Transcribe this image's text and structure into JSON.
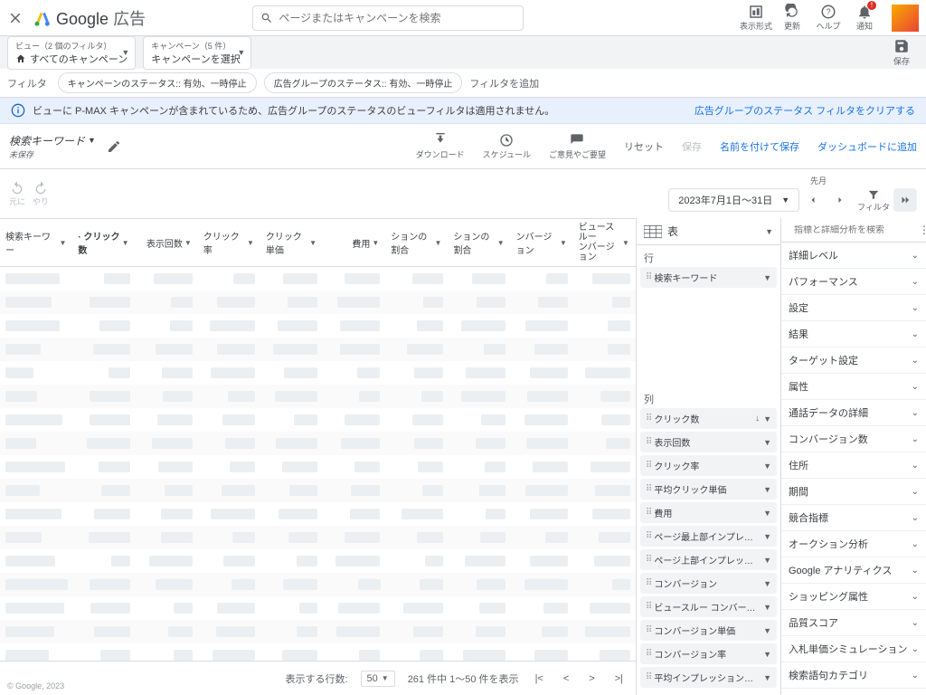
{
  "brand": {
    "name_strong": "Google",
    "name_light": "広告"
  },
  "search": {
    "placeholder": "ページまたはキャンペーンを検索"
  },
  "topactions": {
    "appearance": "表示形式",
    "refresh": "更新",
    "help": "ヘルプ",
    "notifications": "通知"
  },
  "viewbar": {
    "view_sub": "ビュー（2 個のフィルタ）",
    "view_main": "すべてのキャンペーン",
    "campaign_sub": "キャンペーン（5 件）",
    "campaign_main": "キャンペーンを選択",
    "save": "保存"
  },
  "filterbar": {
    "label": "フィルタ",
    "chip1": "キャンペーンのステータス:: 有効、一時停止",
    "chip2": "広告グループのステータス:: 有効、一時停止",
    "add": "フィルタを追加"
  },
  "banner": {
    "text": "ビューに P-MAX キャンペーンが含まれているため、広告グループのステータスのビューフィルタは適用されません。",
    "link": "広告グループのステータス フィルタをクリアする"
  },
  "report": {
    "title": "検索キーワード",
    "unsaved": "未保存",
    "download": "ダウンロード",
    "schedule": "スケジュール",
    "feedback": "ご意見やご要望",
    "reset": "リセット",
    "save": "保存",
    "saveas": "名前を付けて保存",
    "dashboard": "ダッシュボードに追加"
  },
  "daterow": {
    "undo": "元に",
    "redo": "やり",
    "period_label": "先月",
    "period_value": "2023年7月1日～31日",
    "filter": "フィルタ"
  },
  "table": {
    "columns": [
      "検索キーワー",
      "クリック数",
      "表示回数",
      "クリック率",
      "クリック単価",
      "費用",
      "ションの割合",
      "ションの割合",
      "ンバージョン",
      "ビュースルー ンバージョン"
    ],
    "sorted_index": 1,
    "rows_label": "表示する行数:",
    "rows_value": "50",
    "page_status": "261 件中 1～50 件を表示"
  },
  "config": {
    "visual": "表",
    "rows_label": "行",
    "row_items": [
      "検索キーワード"
    ],
    "cols_label": "列",
    "col_items": [
      "クリック数",
      "表示回数",
      "クリック率",
      "平均クリック単価",
      "費用",
      "ページ最上部インプレッションの..",
      "ページ上部インプレッションの割合",
      "コンバージョン",
      "ビュースルー コンバージョン",
      "コンバージョン単価",
      "コンバージョン率",
      "平均インプレッション単価"
    ]
  },
  "metrics": {
    "search_placeholder": "指標と詳細分析を検索",
    "groups": [
      "詳細レベル",
      "パフォーマンス",
      "設定",
      "結果",
      "ターゲット設定",
      "属性",
      "通話データの詳細",
      "コンバージョン数",
      "住所",
      "期間",
      "競合指標",
      "オークション分析",
      "Google アナリティクス",
      "ショッピング属性",
      "品質スコア",
      "入札単価シミュレーション",
      "検索語句カテゴリ"
    ]
  },
  "copyright": "© Google, 2023"
}
